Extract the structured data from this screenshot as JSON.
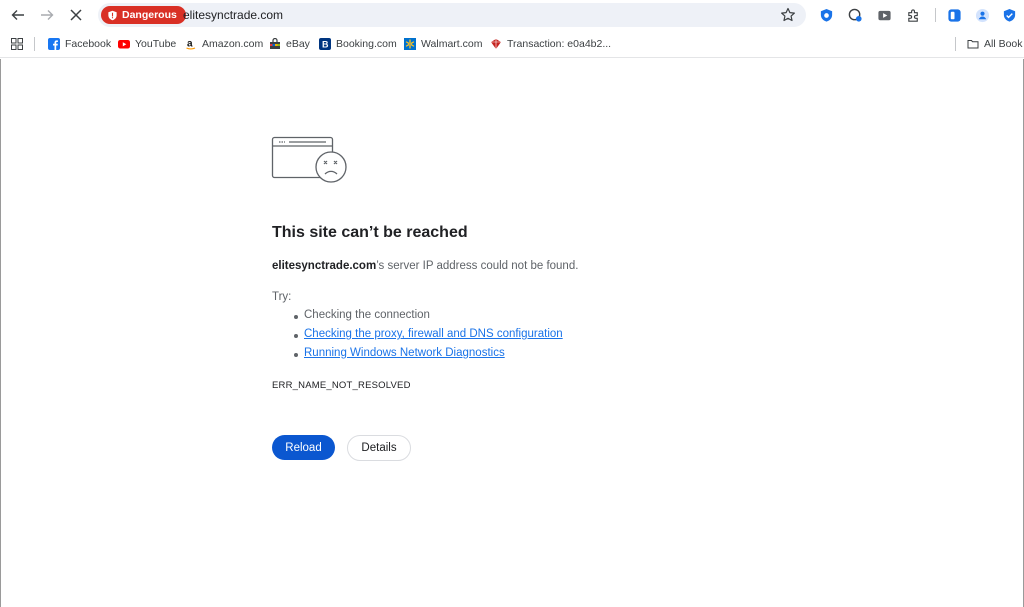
{
  "toolbar": {
    "back_icon": "arrow-left-icon",
    "forward_icon": "arrow-right-icon",
    "stop_icon": "close-icon",
    "security_chip": {
      "label": "Dangerous",
      "color": "#d93025"
    },
    "url": "elitesynctrade.com",
    "star_icon": "star-icon",
    "extensions": [
      "shield-extension-icon",
      "bitwarden-icon",
      "youtube-ext-icon",
      "puzzle-icon",
      "side-panel-icon",
      "profile-icon",
      "vpn-shield-icon"
    ]
  },
  "bookmarks": {
    "items": [
      {
        "label": "Facebook",
        "icon": "facebook-icon"
      },
      {
        "label": "YouTube",
        "icon": "youtube-icon"
      },
      {
        "label": "Amazon.com",
        "icon": "amazon-icon"
      },
      {
        "label": "eBay",
        "icon": "ebay-icon"
      },
      {
        "label": "Booking.com",
        "icon": "booking-icon"
      },
      {
        "label": "Walmart.com",
        "icon": "walmart-icon"
      },
      {
        "label": "Transaction: e0a4b2...",
        "icon": "transaction-icon"
      }
    ],
    "all_bookmarks": "All Book"
  },
  "error_page": {
    "title": "This site can’t be reached",
    "host": "elitesynctrade.com",
    "description_suffix": "’s server IP address could not be found.",
    "try_label": "Try:",
    "suggestions": {
      "s1": "Checking the connection",
      "s2": "Checking the proxy, firewall and DNS configuration",
      "s3": "Running Windows Network Diagnostics"
    },
    "error_code": "ERR_NAME_NOT_RESOLVED",
    "reload_label": "Reload",
    "details_label": "Details"
  },
  "colors": {
    "accent": "#0b57d0",
    "link": "#1a73e8",
    "danger": "#d93025"
  }
}
